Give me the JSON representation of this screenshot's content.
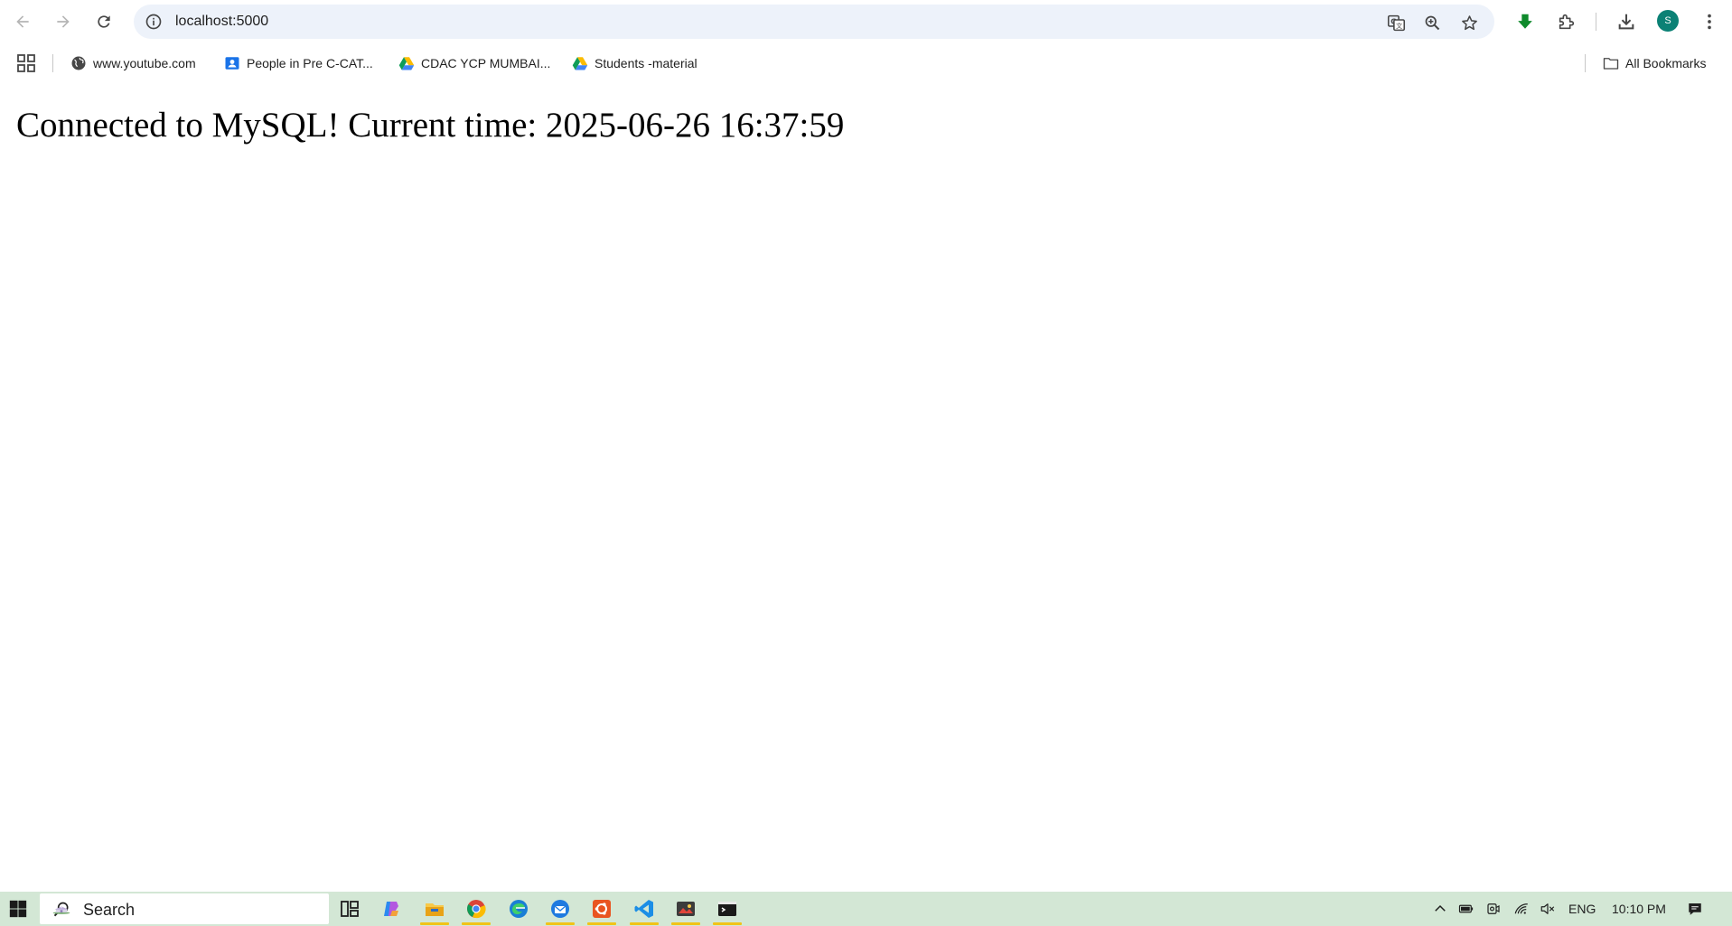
{
  "browser": {
    "url": "localhost:5000",
    "avatar_letter": "S",
    "accent_color": "#0b8175",
    "icons": [
      "back-arrow-icon",
      "forward-arrow-icon",
      "reload-icon",
      "site-info-icon",
      "translate-icon",
      "zoom-icon",
      "star-icon",
      "green-download-extension-icon",
      "extensions-puzzle-icon",
      "downloads-icon",
      "more-vert-icon"
    ]
  },
  "bookmarks": {
    "items": [
      {
        "label": "www.youtube.com",
        "icon": "globe-icon"
      },
      {
        "label": "People in Pre C-CAT...",
        "icon": "contacts-icon"
      },
      {
        "label": "CDAC YCP MUMBAI...",
        "icon": "google-drive-icon"
      },
      {
        "label": "Students -material",
        "icon": "google-drive-icon"
      }
    ],
    "all_bookmarks": "All Bookmarks"
  },
  "page": {
    "message": "Connected to MySQL! Current time: 2025-06-26 16:37:59"
  },
  "taskbar": {
    "search_label": "Search",
    "apps": [
      "task-view-icon",
      "copilot-icon",
      "file-explorer-icon",
      "chrome-icon",
      "edge-icon",
      "thunderbird-icon",
      "ubuntu-icon",
      "vscode-icon",
      "photos-app-icon",
      "terminal-icon"
    ],
    "language": "ENG",
    "time": "10:10 PM",
    "taskbar_color": "#d3e7d5"
  }
}
